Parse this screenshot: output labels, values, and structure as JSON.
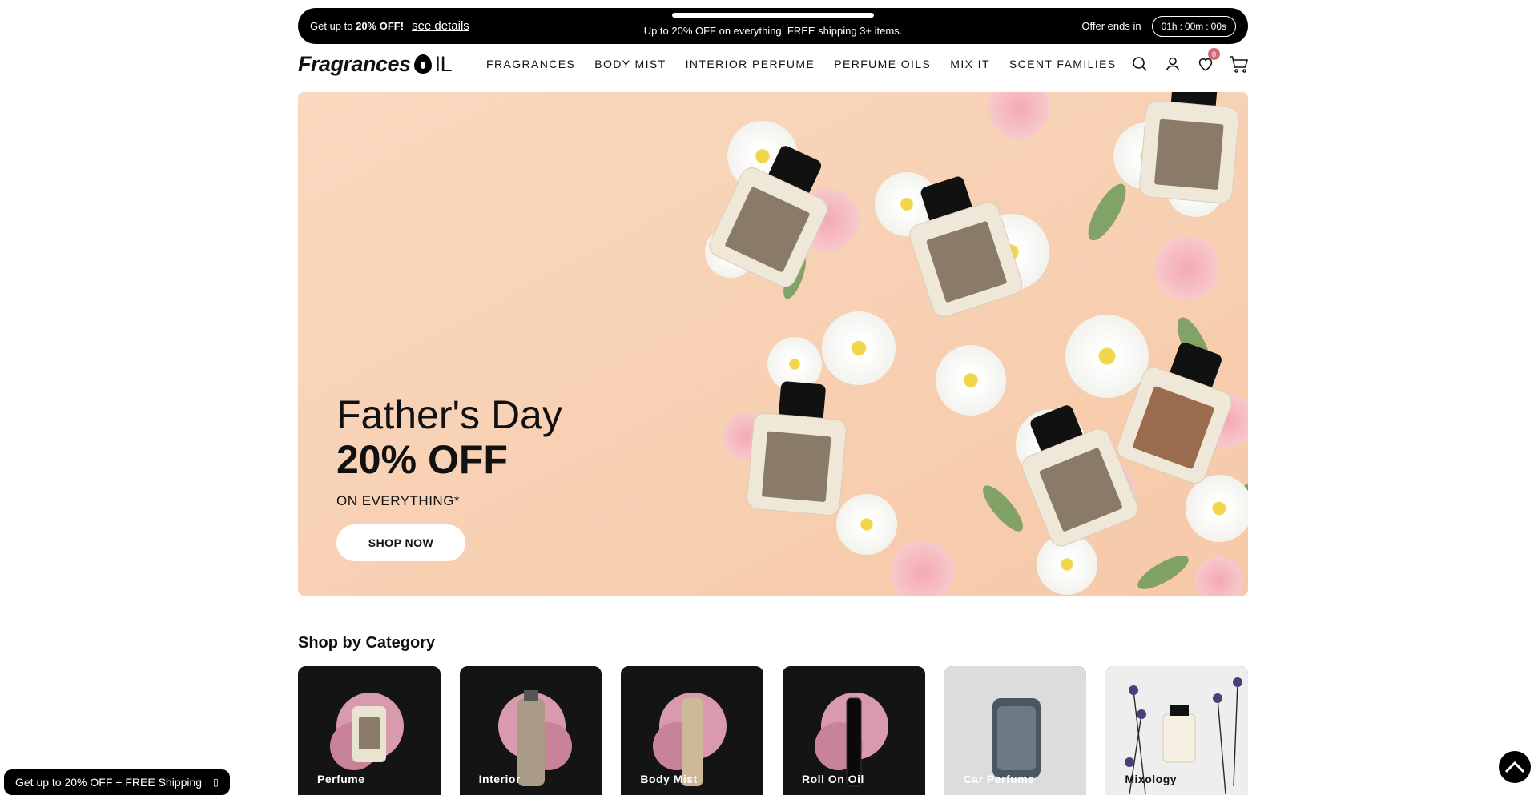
{
  "announcement": {
    "left_prefix": "Get up to ",
    "left_bold": "20% OFF!",
    "details_link": "see details",
    "center_text": "Up to 20% OFF on everything. FREE shipping 3+ items.",
    "offer_label": "Offer ends in",
    "timer": {
      "hours": "01h",
      "minutes": "00m",
      "seconds": "00s",
      "sep": ":"
    }
  },
  "header": {
    "logo_text": "Fragrances",
    "logo_suffix": "IL",
    "nav": [
      "FRAGRANCES",
      "BODY MIST",
      "INTERIOR PERFUME",
      "PERFUME OILS",
      "MIX IT",
      "SCENT FAMILIES"
    ],
    "icons": [
      "search-icon",
      "account-icon",
      "wishlist-icon",
      "cart-icon"
    ],
    "wishlist_count": "0"
  },
  "hero": {
    "line1": "Father's Day",
    "line2": "20% OFF",
    "line3": "ON EVERYTHING*",
    "button": "SHOP NOW"
  },
  "categories": {
    "title": "Shop by Category",
    "items": [
      "Perfume",
      "Interior",
      "Body Mist",
      "Roll On Oil",
      "Car Perfume",
      "Mixology"
    ]
  },
  "floating": {
    "promo": "Get up to 20% OFF + FREE Shipping",
    "promo_close": "▯"
  },
  "colors": {
    "hero_bg": "#f8d3b5",
    "announcement_bg": "#000000",
    "badge": "#d26a73"
  }
}
